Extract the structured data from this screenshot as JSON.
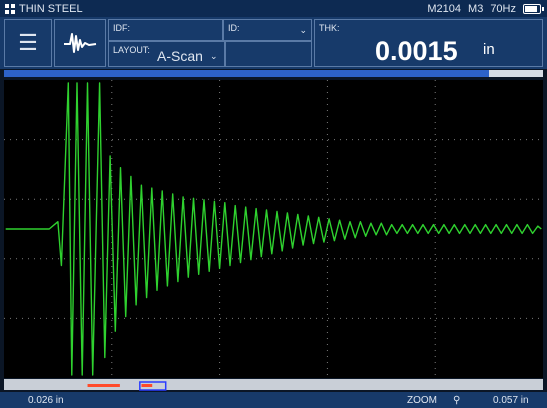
{
  "status_bar": {
    "app_title": "THIN STEEL",
    "model": "M2104",
    "mode": "M3",
    "rate": "70Hz",
    "grid_icon": "grid-icon",
    "battery_icon": "battery-icon"
  },
  "header": {
    "menu_icon": "hamburger-menu-icon",
    "waveform_icon": "waveform-icon",
    "idf_label": "IDF:",
    "id_label": "ID:",
    "layout_label": "LAYOUT:",
    "layout_value": "A-Scan",
    "thk_label": "THK:",
    "thk_value": "0.0015",
    "thk_unit": "in"
  },
  "progress": {
    "value": 0.9
  },
  "footer": {
    "range_start": "0.026 in",
    "zoom_label": "ZOOM",
    "zoom_icon": "magnifier-icon",
    "range_end": "0.057 in"
  },
  "colors": {
    "waveform": "#2fd12f",
    "header_bg": "#173a6a",
    "gate_red": "#ff4a2a",
    "gate_blue": "#2a3cff"
  },
  "gates": [
    {
      "name": "gate-1",
      "color": "red",
      "start": 0.155,
      "end": 0.215
    },
    {
      "name": "gate-2",
      "color": "red",
      "start": 0.255,
      "end": 0.275
    },
    {
      "name": "gate-2-bracket",
      "color": "blue",
      "start": 0.252,
      "end": 0.3
    }
  ],
  "chart_data": {
    "type": "line",
    "xlim": [
      0.026,
      0.057
    ],
    "ylim": [
      -1,
      1
    ],
    "grid": true,
    "series": [
      {
        "points": [
          [
            0.0261,
            0.0
          ],
          [
            0.0286,
            0.0
          ],
          [
            0.0291,
            0.05
          ],
          [
            0.0293,
            -0.25
          ],
          [
            0.0297,
            1.0
          ],
          [
            0.0299,
            -1.0
          ],
          [
            0.0302,
            1.0
          ],
          [
            0.0305,
            -1.0
          ],
          [
            0.0308,
            1.0
          ],
          [
            0.0311,
            -1.0
          ],
          [
            0.0315,
            1.0
          ],
          [
            0.0318,
            -0.88
          ],
          [
            0.0321,
            0.5
          ],
          [
            0.0324,
            -0.7
          ],
          [
            0.0327,
            0.42
          ],
          [
            0.033,
            -0.6
          ],
          [
            0.0333,
            0.36
          ],
          [
            0.0336,
            -0.52
          ],
          [
            0.0339,
            0.3
          ],
          [
            0.0342,
            -0.47
          ],
          [
            0.0345,
            0.28
          ],
          [
            0.0348,
            -0.42
          ],
          [
            0.0351,
            0.26
          ],
          [
            0.0354,
            -0.39
          ],
          [
            0.0357,
            0.24
          ],
          [
            0.036,
            -0.36
          ],
          [
            0.0363,
            0.22
          ],
          [
            0.0366,
            -0.33
          ],
          [
            0.0369,
            0.21
          ],
          [
            0.0372,
            -0.31
          ],
          [
            0.0375,
            0.2
          ],
          [
            0.0378,
            -0.29
          ],
          [
            0.0381,
            0.19
          ],
          [
            0.0384,
            -0.27
          ],
          [
            0.0387,
            0.18
          ],
          [
            0.039,
            -0.25
          ],
          [
            0.0393,
            0.16
          ],
          [
            0.0396,
            -0.23
          ],
          [
            0.0399,
            0.15
          ],
          [
            0.0402,
            -0.21
          ],
          [
            0.0405,
            0.14
          ],
          [
            0.0408,
            -0.19
          ],
          [
            0.0411,
            0.13
          ],
          [
            0.0414,
            -0.17
          ],
          [
            0.0417,
            0.12
          ],
          [
            0.042,
            -0.15
          ],
          [
            0.0423,
            0.11
          ],
          [
            0.0426,
            -0.13
          ],
          [
            0.0429,
            0.1
          ],
          [
            0.0432,
            -0.11
          ],
          [
            0.0435,
            0.09
          ],
          [
            0.0438,
            -0.1
          ],
          [
            0.0441,
            0.08
          ],
          [
            0.0444,
            -0.09
          ],
          [
            0.0447,
            0.07
          ],
          [
            0.045,
            -0.08
          ],
          [
            0.0453,
            0.06
          ],
          [
            0.0456,
            -0.07
          ],
          [
            0.0459,
            0.05
          ],
          [
            0.0462,
            -0.06
          ],
          [
            0.0465,
            0.05
          ],
          [
            0.0468,
            -0.05
          ],
          [
            0.0471,
            0.04
          ],
          [
            0.0474,
            -0.04
          ],
          [
            0.0477,
            0.04
          ],
          [
            0.048,
            -0.04
          ],
          [
            0.0483,
            0.03
          ],
          [
            0.0486,
            -0.03
          ],
          [
            0.0489,
            0.03
          ],
          [
            0.0492,
            -0.03
          ],
          [
            0.0495,
            0.03
          ],
          [
            0.0498,
            -0.03
          ],
          [
            0.0501,
            0.03
          ],
          [
            0.0504,
            -0.03
          ],
          [
            0.0507,
            0.03
          ],
          [
            0.051,
            -0.03
          ],
          [
            0.0513,
            0.03
          ],
          [
            0.0516,
            -0.03
          ],
          [
            0.0519,
            0.03
          ],
          [
            0.0522,
            -0.03
          ],
          [
            0.0525,
            0.03
          ],
          [
            0.0528,
            -0.03
          ],
          [
            0.0531,
            0.03
          ],
          [
            0.0534,
            -0.03
          ],
          [
            0.0537,
            0.03
          ],
          [
            0.054,
            -0.03
          ],
          [
            0.0543,
            0.03
          ],
          [
            0.0546,
            -0.03
          ],
          [
            0.0549,
            0.03
          ],
          [
            0.0552,
            -0.03
          ],
          [
            0.0555,
            0.03
          ],
          [
            0.0558,
            -0.03
          ],
          [
            0.0561,
            0.03
          ],
          [
            0.0564,
            -0.03
          ],
          [
            0.0567,
            0.02
          ],
          [
            0.0569,
            0.0
          ]
        ]
      }
    ]
  }
}
